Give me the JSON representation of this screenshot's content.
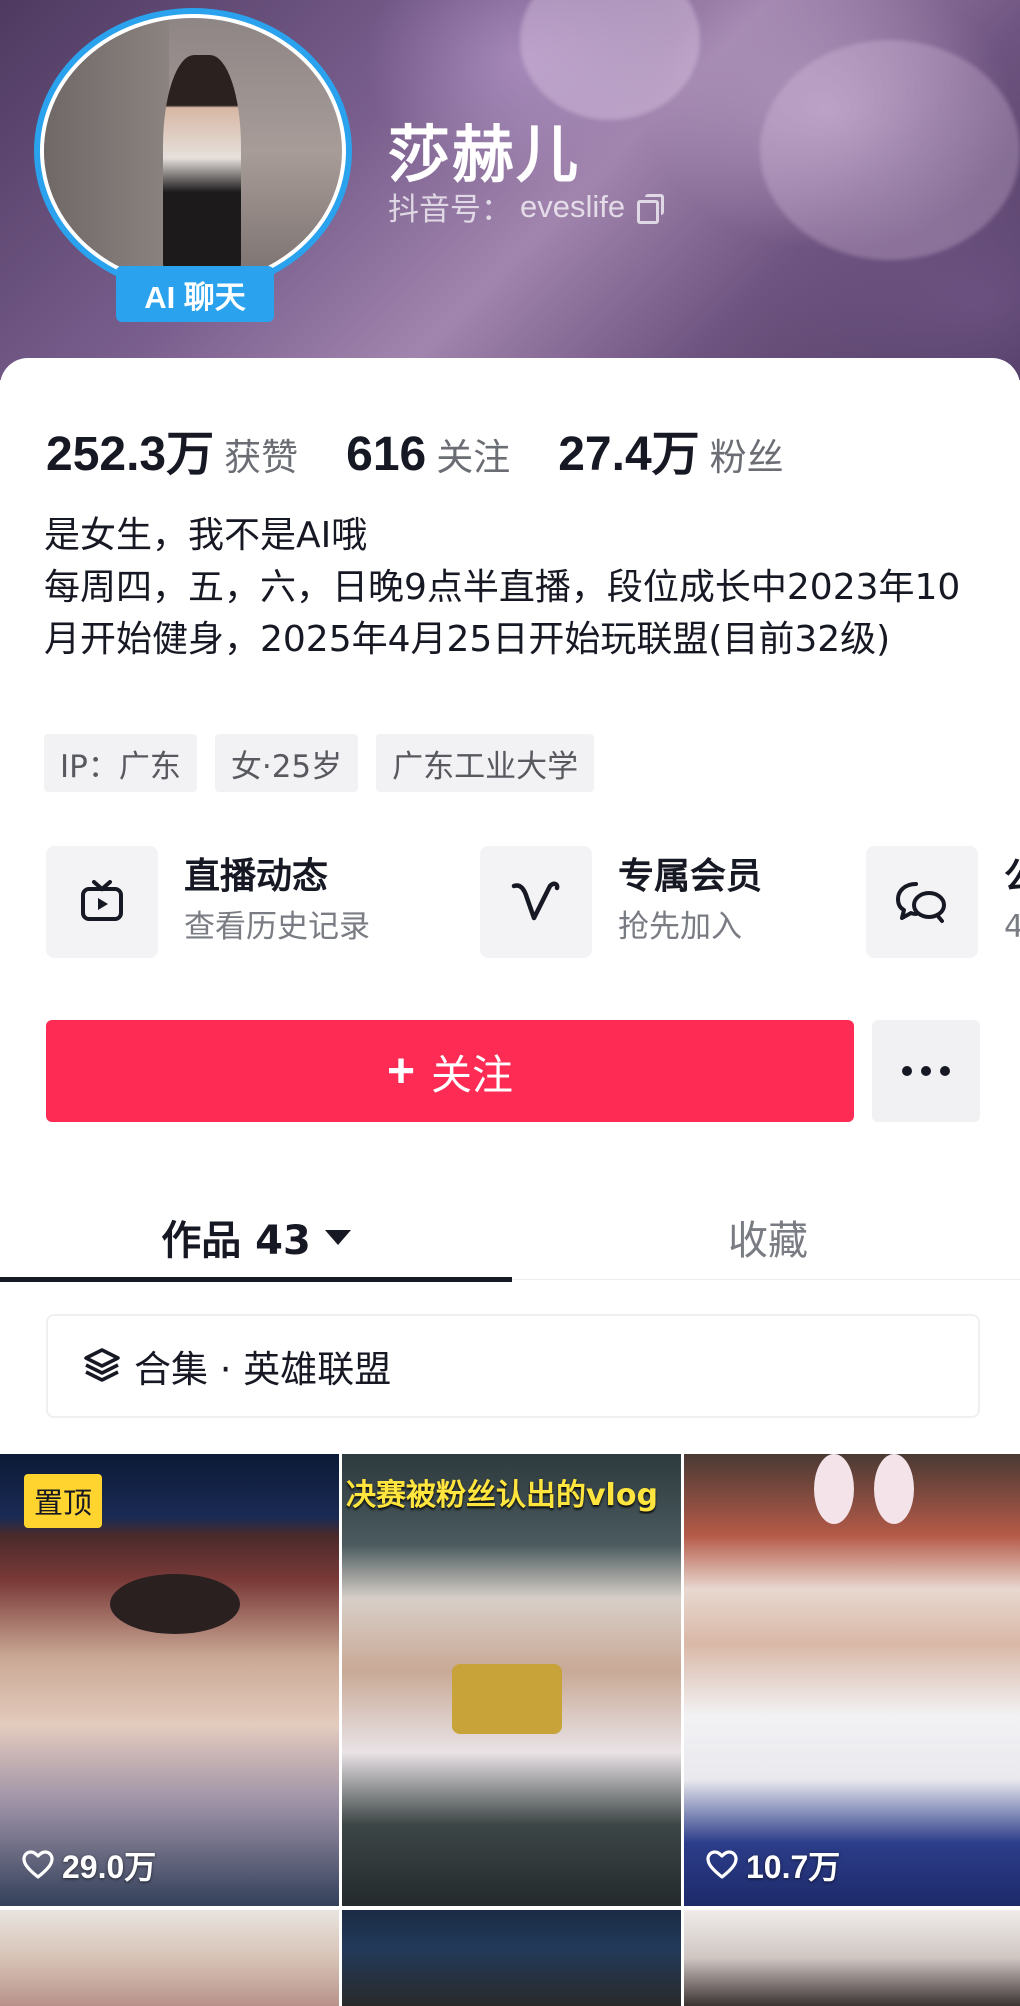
{
  "profile": {
    "name": "莎赫儿",
    "douyin_id_label": "抖音号：",
    "douyin_id": "eveslife",
    "ai_chat_label": "AI 聊天"
  },
  "stats": [
    {
      "value": "252.3万",
      "label": "获赞"
    },
    {
      "value": "616",
      "label": "关注"
    },
    {
      "value": "27.4万",
      "label": "粉丝"
    }
  ],
  "bio": {
    "line1": "是女生，我不是AI哦",
    "line2": "每周四，五，六，日晚9点半直播，段位成长中2023年10月开始健身，2025年4月25日开始玩联盟(目前32级)"
  },
  "tags": [
    "IP：广东",
    "女·25岁",
    "广东工业大学"
  ],
  "features": [
    {
      "title": "直播动态",
      "subtitle": "查看历史记录",
      "icon": "tv-icon"
    },
    {
      "title": "专属会员",
      "subtitle": "抢先加入",
      "icon": "v-member-icon"
    },
    {
      "title": "公",
      "subtitle": "4",
      "icon": "chat-bubbles-icon"
    }
  ],
  "actions": {
    "follow_label": "关注",
    "follow_color": "#fe2c55",
    "more_icon": "more-dots-icon"
  },
  "tabs": {
    "works_label": "作品 43",
    "collect_label": "收藏"
  },
  "collection": {
    "label": "合集 · 英雄联盟",
    "icon": "layers-icon"
  },
  "videos": [
    {
      "pinned_label": "置顶",
      "likes": "29.0万",
      "caption": ""
    },
    {
      "pinned_label": "",
      "likes": "",
      "caption": "决赛被粉丝认出的vlog"
    },
    {
      "pinned_label": "",
      "likes": "10.7万",
      "caption": ""
    }
  ],
  "colors": {
    "accent_blue": "#2aa2ee",
    "pin_yellow": "#ffd42e"
  }
}
